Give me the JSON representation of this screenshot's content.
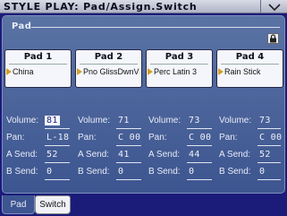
{
  "window": {
    "title": "STYLE PLAY: Pad/Assign.Switch"
  },
  "panel": {
    "label": "Pad"
  },
  "pads": [
    {
      "title": "Pad 1",
      "sound": "China"
    },
    {
      "title": "Pad 2",
      "sound": "Pno GlissDwnV"
    },
    {
      "title": "Pad 3",
      "sound": "Perc Latin 3"
    },
    {
      "title": "Pad 4",
      "sound": "Rain Stick"
    }
  ],
  "labels": {
    "volume": "Volume:",
    "pan": "Pan:",
    "a_send": "A Send:",
    "b_send": "B Send:"
  },
  "params": [
    {
      "volume": "81",
      "pan": "L-18",
      "a_send": "52",
      "b_send": "0"
    },
    {
      "volume": "71",
      "pan": "C 00",
      "a_send": "41",
      "b_send": "0"
    },
    {
      "volume": "73",
      "pan": "C 00",
      "a_send": "44",
      "b_send": "0"
    },
    {
      "volume": "73",
      "pan": "C 00",
      "a_send": "52",
      "b_send": "0"
    }
  ],
  "tabs": [
    {
      "label": "Pad",
      "active": true
    },
    {
      "label": "Switch",
      "active": false
    }
  ],
  "icons": {
    "menu": "chevron-down-icon",
    "lock": "lock-icon",
    "pad_marker": "triangle-right-icon"
  },
  "colors": {
    "background": "#1b1b7a",
    "panel": "#4a64a0",
    "pad_marker": "#d1a02a"
  }
}
